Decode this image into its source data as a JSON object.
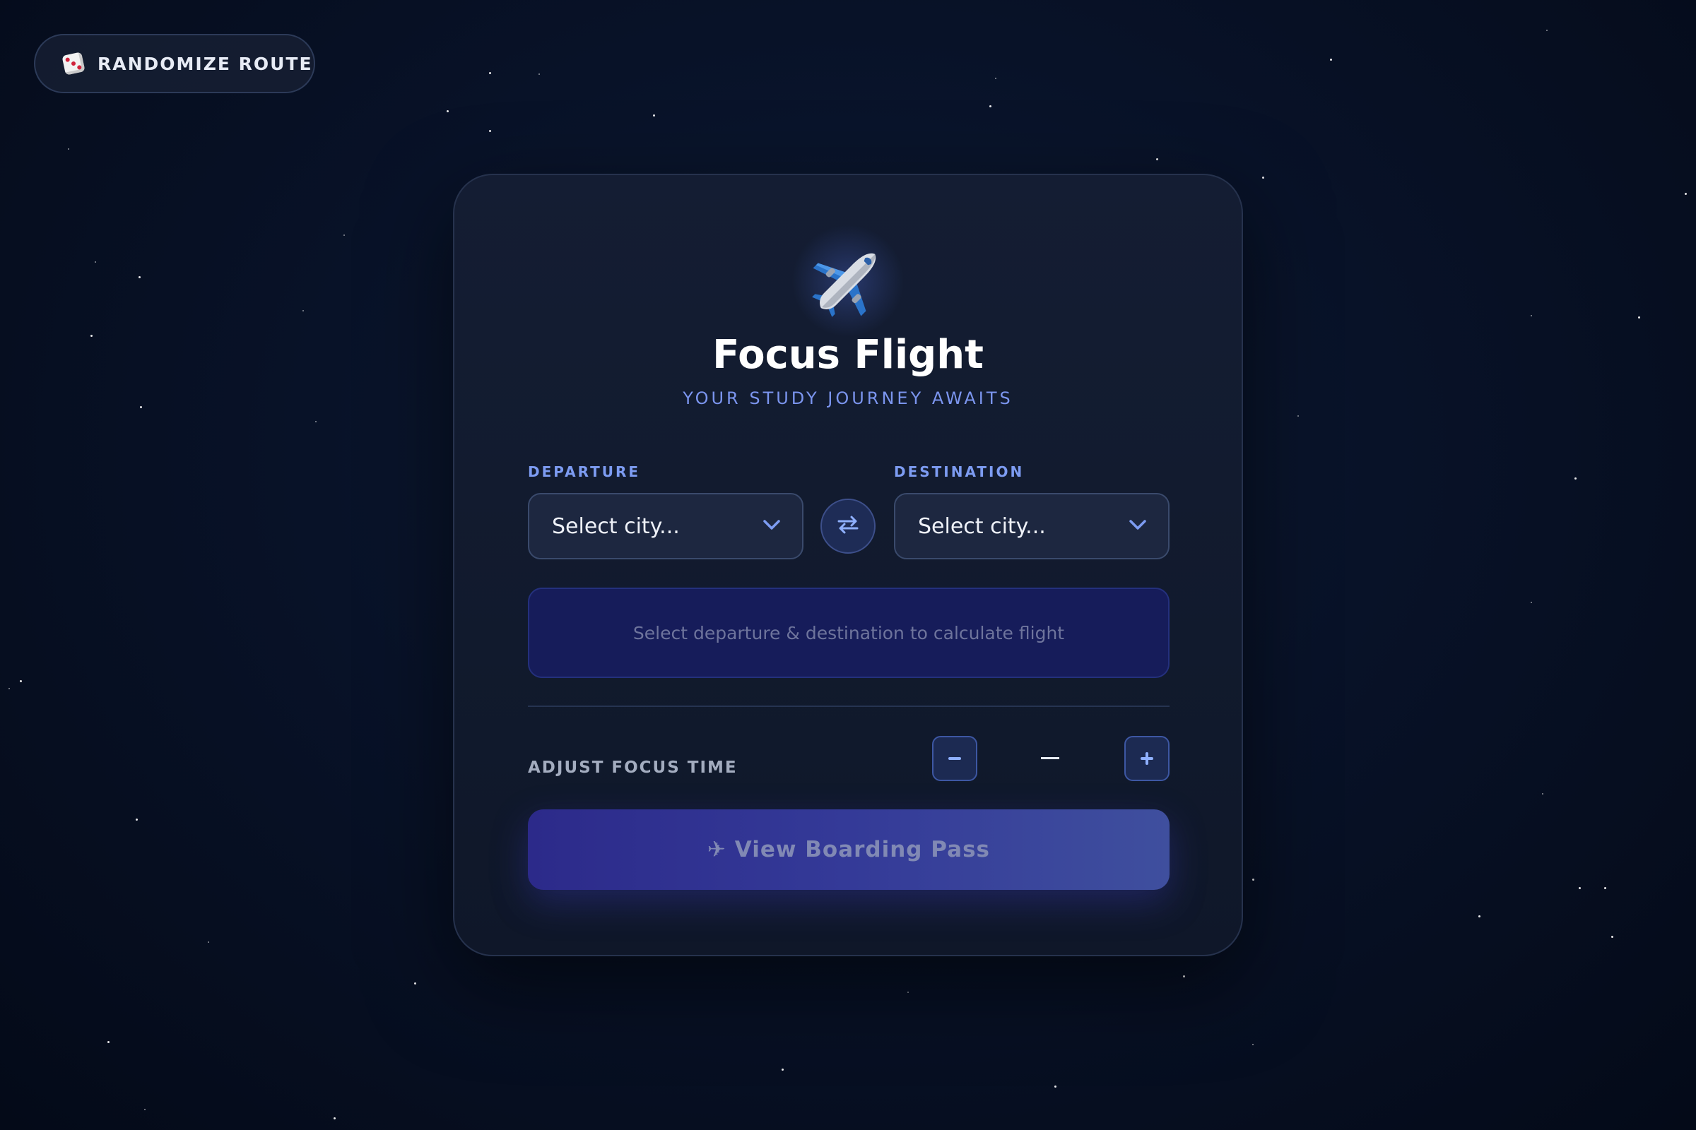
{
  "toolbar": {
    "randomize_label": "RANDOMIZE ROUTE",
    "randomize_icon": "dice-icon"
  },
  "card": {
    "icon": "airplane-icon",
    "title": "Focus Flight",
    "subtitle": "YOUR STUDY JOURNEY AWAITS"
  },
  "departure": {
    "label": "DEPARTURE",
    "value": "Select city..."
  },
  "destination": {
    "label": "DESTINATION",
    "value": "Select city..."
  },
  "swap": {
    "icon": "swap-arrows-icon"
  },
  "flight_info": {
    "message": "Select departure & destination to calculate flight"
  },
  "focus_time": {
    "label": "ADJUST FOCUS TIME",
    "decrement_label": "−",
    "increment_label": "+",
    "value": "—"
  },
  "boarding": {
    "label": "✈ View Boarding Pass"
  },
  "colors": {
    "accent": "#7d9cf2",
    "background": "#081228",
    "card": "#141d33",
    "button": "#343a98"
  }
}
